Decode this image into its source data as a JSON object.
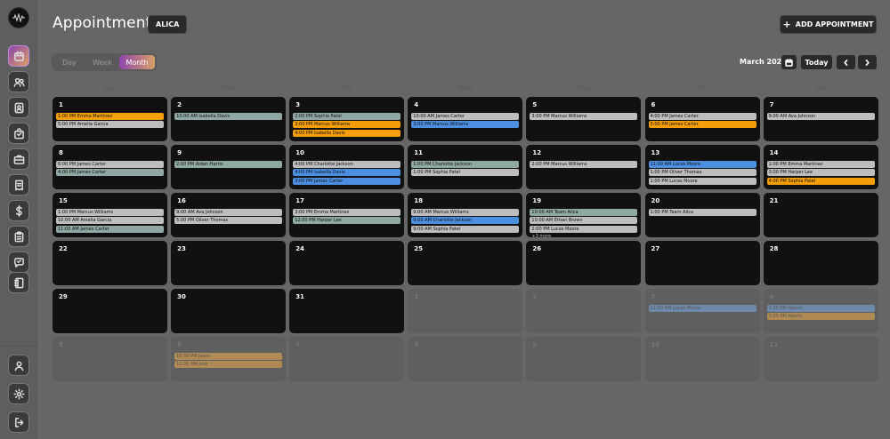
{
  "header": {
    "title": "Appointments",
    "user_badge": "ALICA",
    "add_button": "ADD APPOINTMENT"
  },
  "view": {
    "options": [
      "Day",
      "Week",
      "Month"
    ],
    "selected": "Month"
  },
  "nav": {
    "month_label": "March 2026",
    "today_label": "Today"
  },
  "sidebar": {
    "items": [
      {
        "name": "calendar-icon",
        "active": true
      },
      {
        "name": "users-icon",
        "active": false
      },
      {
        "name": "contact-card-icon",
        "active": false
      },
      {
        "name": "bag-icon",
        "active": false
      },
      {
        "name": "briefcase-icon",
        "active": false
      },
      {
        "name": "receipt-icon",
        "active": false
      },
      {
        "name": "dollar-icon",
        "active": false
      },
      {
        "name": "clipboard-icon",
        "active": false
      },
      {
        "name": "chat-icon",
        "active": false
      },
      {
        "name": "book-icon",
        "active": false
      }
    ],
    "bottom": [
      {
        "name": "profile-icon"
      },
      {
        "name": "settings-icon"
      },
      {
        "name": "logout-icon"
      }
    ]
  },
  "weekdays": [
    "Sun",
    "Mon",
    "Tue",
    "Wed",
    "Thu",
    "Fri",
    "Sat"
  ],
  "colors": {
    "accent_start": "#8e44ad",
    "accent_end": "#d9a066",
    "event_gray": "#bdbdbd",
    "event_teal": "#8fa8a4",
    "event_orange": "#f59e0b",
    "event_blue": "#4c8fe0"
  },
  "weeks": [
    [
      {
        "day": "1",
        "outside": false,
        "events": [
          {
            "text": "1:00 PM Emma Martinez",
            "color": "orange"
          },
          {
            "text": "5:00 PM Amelia Garcia",
            "color": "gray"
          }
        ]
      },
      {
        "day": "2",
        "outside": false,
        "events": [
          {
            "text": "10:00 AM Isabella Davis",
            "color": "teal"
          }
        ]
      },
      {
        "day": "3",
        "outside": false,
        "events": [
          {
            "text": "2:00 PM Sophia Patel",
            "color": "teal"
          },
          {
            "text": "3:00 PM Marcus Williams",
            "color": "orange"
          },
          {
            "text": "4:00 PM Isabella Davis",
            "color": "orange"
          }
        ]
      },
      {
        "day": "4",
        "outside": false,
        "events": [
          {
            "text": "10:00 AM James Carter",
            "color": "gray"
          },
          {
            "text": "3:00 PM Marcus Williams",
            "color": "blue"
          }
        ]
      },
      {
        "day": "5",
        "outside": false,
        "events": [
          {
            "text": "3:00 PM Marcus Williams",
            "color": "gray"
          }
        ]
      },
      {
        "day": "6",
        "outside": false,
        "events": [
          {
            "text": "4:00 PM James Carter",
            "color": "gray"
          },
          {
            "text": "5:00 PM James Carter",
            "color": "orange"
          }
        ]
      },
      {
        "day": "7",
        "outside": false,
        "events": [
          {
            "text": "9:00 AM Ava Johnson",
            "color": "gray"
          }
        ]
      }
    ],
    [
      {
        "day": "8",
        "outside": false,
        "events": [
          {
            "text": "6:00 PM James Carter",
            "color": "gray"
          },
          {
            "text": "4:00 PM James Carter",
            "color": "teal"
          }
        ]
      },
      {
        "day": "9",
        "outside": false,
        "events": [
          {
            "text": "2:00 PM Aiden Harris",
            "color": "teal"
          }
        ]
      },
      {
        "day": "10",
        "outside": false,
        "events": [
          {
            "text": "4:00 PM Charlotte Jackson",
            "color": "gray"
          },
          {
            "text": "4:00 PM Isabella Davis",
            "color": "blue"
          },
          {
            "text": "3:00 PM James Carter",
            "color": "blue"
          }
        ]
      },
      {
        "day": "11",
        "outside": false,
        "events": [
          {
            "text": "1:00 PM Charlotte Jackson",
            "color": "teal"
          },
          {
            "text": "1:00 PM Sophia Patel",
            "color": "gray"
          }
        ]
      },
      {
        "day": "12",
        "outside": false,
        "events": [
          {
            "text": "2:00 PM Marcus Williams",
            "color": "gray"
          }
        ]
      },
      {
        "day": "13",
        "outside": false,
        "events": [
          {
            "text": "11:00 AM Lucas Moore",
            "color": "blue"
          },
          {
            "text": "1:00 PM Oliver Thomas",
            "color": "gray"
          },
          {
            "text": "1:00 PM Lucas Moore",
            "color": "gray"
          }
        ]
      },
      {
        "day": "14",
        "outside": false,
        "events": [
          {
            "text": "1:00 PM Emma Martinez",
            "color": "gray"
          },
          {
            "text": "3:00 PM Harper Lee",
            "color": "gray"
          },
          {
            "text": "4:00 PM Sophia Patel",
            "color": "orange"
          }
        ]
      }
    ],
    [
      {
        "day": "15",
        "outside": false,
        "events": [
          {
            "text": "1:00 PM Marcus Williams",
            "color": "gray"
          },
          {
            "text": "10:00 AM Amelia Garcia",
            "color": "gray"
          },
          {
            "text": "11:00 AM James Carter",
            "color": "teal"
          }
        ]
      },
      {
        "day": "16",
        "outside": false,
        "events": [
          {
            "text": "9:00 AM Ava Johnson",
            "color": "gray"
          },
          {
            "text": "5:00 PM Oliver Thomas",
            "color": "gray"
          }
        ]
      },
      {
        "day": "17",
        "outside": false,
        "events": [
          {
            "text": "3:00 PM Emma Martinez",
            "color": "gray"
          },
          {
            "text": "12:00 PM Harper Lee",
            "color": "teal"
          }
        ]
      },
      {
        "day": "18",
        "outside": false,
        "events": [
          {
            "text": "9:00 AM Marcus Williams",
            "color": "gray"
          },
          {
            "text": "9:00 AM Charlotte Jackson",
            "color": "blue"
          },
          {
            "text": "9:00 AM Sophia Patel",
            "color": "gray"
          }
        ]
      },
      {
        "day": "19",
        "outside": false,
        "events": [
          {
            "text": "10:00 AM Team Alica",
            "color": "teal"
          },
          {
            "text": "10:00 AM Ethan Brown",
            "color": "gray"
          },
          {
            "text": "2:00 PM Lucas Moore",
            "color": "gray"
          }
        ],
        "more": "+3 more"
      },
      {
        "day": "20",
        "outside": false,
        "events": [
          {
            "text": "1:00 PM Team Alica",
            "color": "gray"
          }
        ]
      },
      {
        "day": "21",
        "outside": false,
        "events": []
      }
    ],
    [
      {
        "day": "22",
        "outside": false,
        "events": []
      },
      {
        "day": "23",
        "outside": false,
        "events": []
      },
      {
        "day": "24",
        "outside": false,
        "events": []
      },
      {
        "day": "25",
        "outside": false,
        "events": []
      },
      {
        "day": "26",
        "outside": false,
        "events": []
      },
      {
        "day": "27",
        "outside": false,
        "events": []
      },
      {
        "day": "28",
        "outside": false,
        "events": []
      }
    ],
    [
      {
        "day": "29",
        "outside": false,
        "events": []
      },
      {
        "day": "30",
        "outside": false,
        "events": []
      },
      {
        "day": "31",
        "outside": false,
        "events": []
      },
      {
        "day": "1",
        "outside": true,
        "events": []
      },
      {
        "day": "2",
        "outside": true,
        "events": []
      },
      {
        "day": "3",
        "outside": true,
        "events": [
          {
            "text": "11:00 AM Lucas Moore",
            "color": "blue"
          }
        ]
      },
      {
        "day": "4",
        "outside": true,
        "events": [
          {
            "text": "1:00 PM Naomi",
            "color": "blue"
          },
          {
            "text": "3:00 PM Naomi",
            "color": "orange"
          }
        ]
      }
    ],
    [
      {
        "day": "5",
        "outside": true,
        "events": []
      },
      {
        "day": "6",
        "outside": true,
        "events": [
          {
            "text": "10:30 PM Jason",
            "color": "orange"
          },
          {
            "text": "11:00 AM Jose",
            "color": "orange"
          }
        ]
      },
      {
        "day": "7",
        "outside": true,
        "events": []
      },
      {
        "day": "8",
        "outside": true,
        "events": []
      },
      {
        "day": "9",
        "outside": true,
        "events": []
      },
      {
        "day": "10",
        "outside": true,
        "events": []
      },
      {
        "day": "11",
        "outside": true,
        "events": []
      }
    ]
  ]
}
